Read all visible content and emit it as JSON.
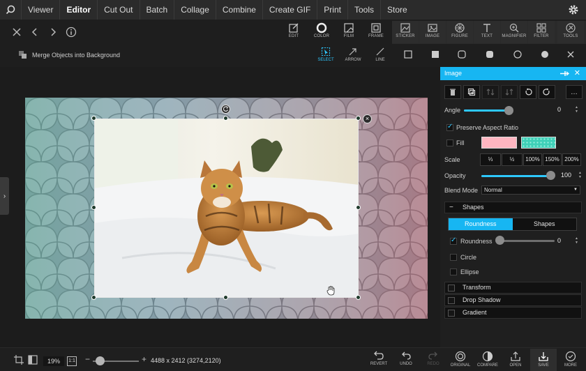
{
  "menu": {
    "items": [
      "Viewer",
      "Editor",
      "Cut Out",
      "Batch",
      "Collage",
      "Combine",
      "Create GIF",
      "Print",
      "Tools",
      "Store"
    ],
    "active_index": 1
  },
  "toolbar": {
    "tools": [
      {
        "label": "EDIT",
        "icon": "edit-icon"
      },
      {
        "label": "COLOR",
        "icon": "color-icon"
      },
      {
        "label": "FILM",
        "icon": "film-icon"
      },
      {
        "label": "FRAME",
        "icon": "frame-icon"
      },
      {
        "label": "STICKER",
        "icon": "sticker-icon"
      },
      {
        "label": "IMAGE",
        "icon": "image-icon"
      },
      {
        "label": "FIGURE",
        "icon": "figure-icon"
      },
      {
        "label": "TEXT",
        "icon": "text-icon"
      },
      {
        "label": "MAGNIFIER",
        "icon": "magnifier-icon"
      },
      {
        "label": "FILTER",
        "icon": "filter-icon"
      },
      {
        "label": "TOOLS",
        "icon": "tools-icon"
      }
    ]
  },
  "subbar": {
    "merge_label": "Merge Objects into Background",
    "tools": [
      {
        "label": "SELECT",
        "active": true
      },
      {
        "label": "ARROW",
        "active": false
      },
      {
        "label": "LINE",
        "active": false
      }
    ]
  },
  "panel": {
    "title": "Image",
    "angle_label": "Angle",
    "angle_value": "0",
    "preserve_label": "Preserve Aspect Ratio",
    "preserve_checked": true,
    "fill_label": "Fill",
    "scale_label": "Scale",
    "scale_options": [
      "⅓",
      "½",
      "100%",
      "150%",
      "200%"
    ],
    "opacity_label": "Opacity",
    "opacity_value": "100",
    "blend_label": "Blend Mode",
    "blend_value": "Normal",
    "shapes_section": "Shapes",
    "seg_options": [
      "Roundness",
      "Shapes"
    ],
    "roundness_label": "Roundness",
    "roundness_value": "0",
    "circle_label": "Circle",
    "ellipse_label": "Ellipse",
    "sections": [
      "Transform",
      "Drop Shadow",
      "Gradient"
    ],
    "colors": {
      "accent": "#17b6f2",
      "fill_pink": "#ffb6c1",
      "fill_teal": "#3fd0b8"
    }
  },
  "bottom": {
    "zoom": "19%",
    "zoom_fit": "1:1",
    "dimensions": "4488 x 2412  (3274,2120)",
    "buttons": [
      {
        "label": "REVERT",
        "disabled": false
      },
      {
        "label": "UNDO",
        "disabled": false
      },
      {
        "label": "REDO",
        "disabled": true
      },
      {
        "label": "ORIGINAL",
        "disabled": false
      },
      {
        "label": "COMPARE",
        "disabled": false
      },
      {
        "label": "OPEN",
        "disabled": false
      },
      {
        "label": "SAVE",
        "disabled": false
      },
      {
        "label": "MORE",
        "disabled": false
      }
    ]
  }
}
